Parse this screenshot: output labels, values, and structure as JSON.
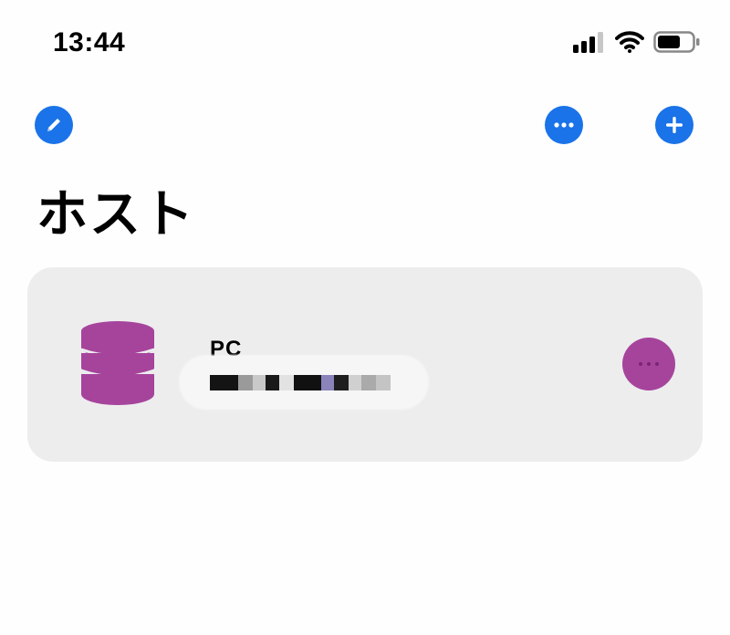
{
  "status_bar": {
    "time": "13:44",
    "icons": [
      "signal-icon",
      "wifi-icon",
      "battery-icon"
    ]
  },
  "toolbar": {
    "edit_icon": "pencil-icon",
    "more_icon": "ellipsis-icon",
    "add_icon": "plus-icon",
    "accent_color": "#1a73e8"
  },
  "page": {
    "title": "ホスト"
  },
  "hosts": [
    {
      "name": "PC",
      "icon": "database-icon",
      "icon_color": "#a6449c",
      "address_redacted": true
    }
  ]
}
